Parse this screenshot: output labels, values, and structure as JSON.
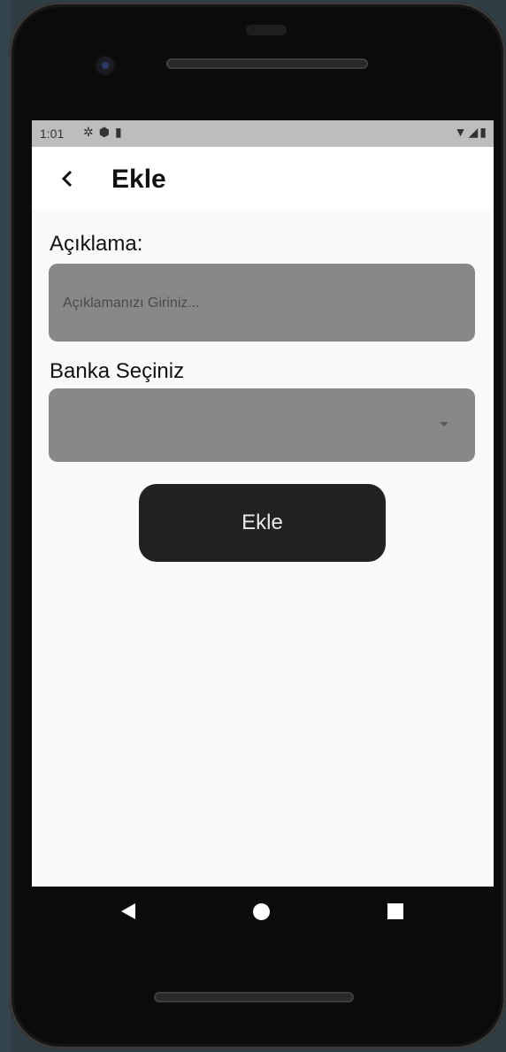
{
  "status_bar": {
    "time": "1:01",
    "left_icons": [
      "settings-gear-icon",
      "shield-icon",
      "sd-card-icon"
    ],
    "right_icons": [
      "wifi-icon",
      "signal-icon",
      "battery-icon"
    ]
  },
  "app_bar": {
    "back_icon": "chevron-left-icon",
    "title": "Ekle"
  },
  "form": {
    "description_label": "Açıklama:",
    "description_placeholder": "Açıklamanızı Giriniz...",
    "description_value": "",
    "bank_label": "Banka Seçiniz",
    "bank_selected": "",
    "submit_label": "Ekle"
  },
  "nav_bar": {
    "buttons": [
      "back-triangle-icon",
      "home-circle-icon",
      "recents-square-icon"
    ]
  },
  "colors": {
    "field_background": "#888888",
    "button_background": "#222222",
    "screen_background": "#fafafa",
    "status_bar": "#bdbdbd"
  }
}
